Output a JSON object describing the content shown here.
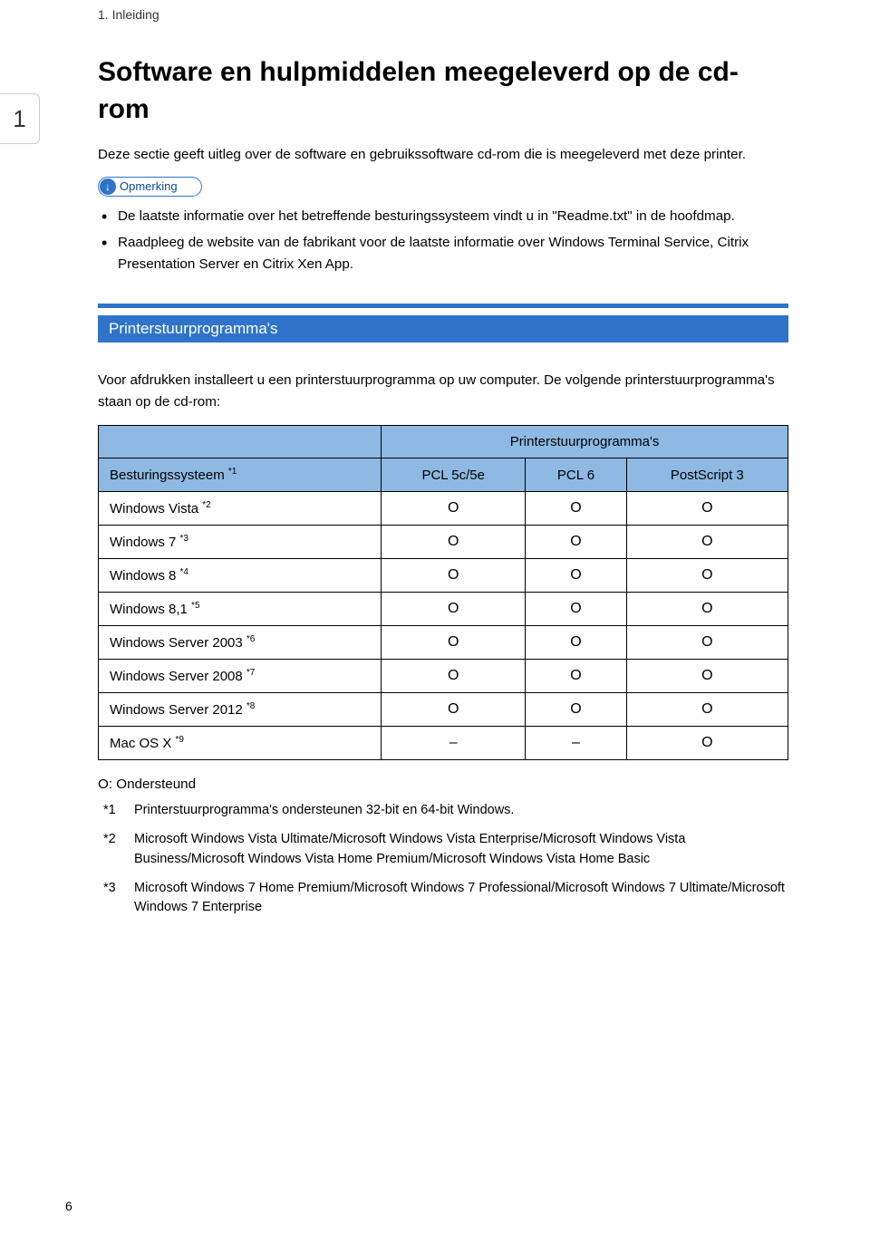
{
  "breadcrumb": "1. Inleiding",
  "chapter_tab": "1",
  "title": "Software en hulpmiddelen meegeleverd op de cd-rom",
  "intro": "Deze sectie geeft uitleg over de software en gebruikssoftware cd-rom die is meegeleverd met deze printer.",
  "note_label": "Opmerking",
  "bullets": [
    "De laatste informatie over het betreffende besturingssysteem vindt u in \"Readme.txt\" in de hoofdmap.",
    "Raadpleeg de website van de fabrikant voor de laatste informatie over Windows Terminal Service, Citrix Presentation Server en Citrix Xen App."
  ],
  "section_title": "Printerstuurprogramma's",
  "section_text": "Voor afdrukken installeert u een printerstuurprogramma op uw computer. De volgende printerstuurprogramma's staan op de cd-rom:",
  "table": {
    "group_header": "Printerstuurprogramma's",
    "os_header": "Besturingssysteem ",
    "os_header_sup": "*1",
    "columns": [
      "PCL 5c/5e",
      "PCL 6",
      "PostScript 3"
    ],
    "rows": [
      {
        "label": "Windows Vista ",
        "sup": "*2",
        "cells": [
          "O",
          "O",
          "O"
        ]
      },
      {
        "label": "Windows 7 ",
        "sup": "*3",
        "cells": [
          "O",
          "O",
          "O"
        ]
      },
      {
        "label": "Windows 8 ",
        "sup": "*4",
        "cells": [
          "O",
          "O",
          "O"
        ]
      },
      {
        "label": "Windows 8,1 ",
        "sup": "*5",
        "cells": [
          "O",
          "O",
          "O"
        ]
      },
      {
        "label": "Windows Server 2003 ",
        "sup": "*6",
        "cells": [
          "O",
          "O",
          "O"
        ]
      },
      {
        "label": "Windows Server 2008 ",
        "sup": "*7",
        "cells": [
          "O",
          "O",
          "O"
        ]
      },
      {
        "label": "Windows Server 2012 ",
        "sup": "*8",
        "cells": [
          "O",
          "O",
          "O"
        ]
      },
      {
        "label": "Mac OS X ",
        "sup": "*9",
        "cells": [
          "–",
          "–",
          "O"
        ]
      }
    ]
  },
  "legend_mark": "O",
  "legend_text": ": Ondersteund",
  "footnotes": [
    {
      "marker": "*1",
      "text": "Printerstuurprogramma's ondersteunen 32-bit en 64-bit Windows."
    },
    {
      "marker": "*2",
      "text": "Microsoft Windows Vista Ultimate/Microsoft Windows Vista Enterprise/Microsoft Windows Vista Business/Microsoft Windows Vista Home Premium/Microsoft Windows Vista Home Basic"
    },
    {
      "marker": "*3",
      "text": "Microsoft Windows 7 Home Premium/Microsoft Windows 7 Professional/Microsoft Windows 7 Ultimate/Microsoft Windows 7 Enterprise"
    }
  ],
  "page_number": "6"
}
